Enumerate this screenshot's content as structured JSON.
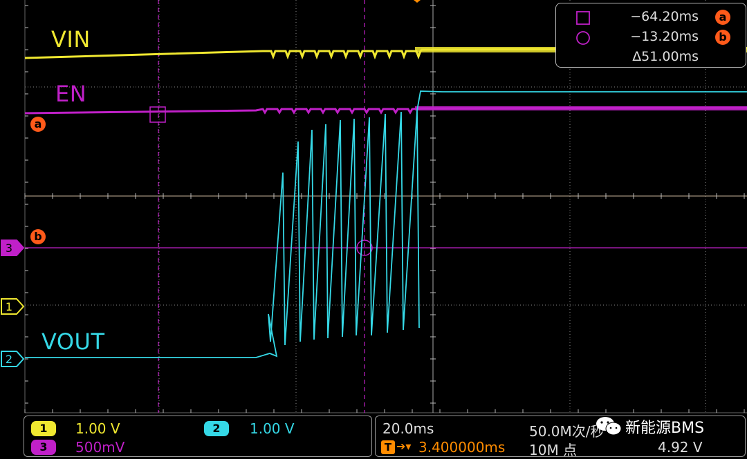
{
  "channels": {
    "vin_label": "VIN",
    "en_label": "EN",
    "vout_label": "VOUT",
    "ch1_marker": "1",
    "ch2_marker": "2",
    "ch3_marker": "3"
  },
  "colors": {
    "ch1": "#f0e830",
    "ch2": "#35d8e6",
    "ch3": "#c020c8",
    "cursor_badge": "#ff5a1a",
    "grid": "#8a8a8a"
  },
  "cursors": {
    "a_label": "a",
    "b_label": "b",
    "a_time": "−64.20ms",
    "b_time": "−13.20ms",
    "delta": "Δ51.00ms"
  },
  "status": {
    "ch1_num": "1",
    "ch1_scale": "1.00 V",
    "ch2_num": "2",
    "ch2_scale": "1.00 V",
    "ch3_num": "3",
    "ch3_scale": "500mV",
    "timebase": "20.0ms",
    "trigger_pos": "3.400000ms",
    "sample_rate": "50.0M次/秒",
    "record_length": "10M 点",
    "trigger_level": "4.92 V"
  },
  "watermark": {
    "text": "新能源BMS",
    "icon": "wechat-icon"
  }
}
